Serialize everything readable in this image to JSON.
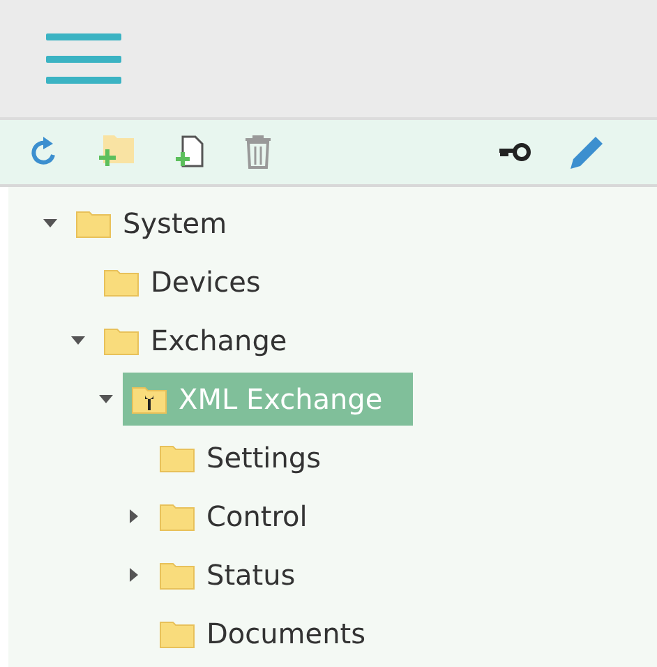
{
  "tree": [
    {
      "label": "System",
      "kind": "folder",
      "expanded": true,
      "selected": false,
      "children": [
        {
          "label": "Devices",
          "kind": "folder",
          "selected": false
        },
        {
          "label": "Exchange",
          "kind": "folder",
          "expanded": true,
          "selected": false,
          "children": [
            {
              "label": "XML Exchange",
              "kind": "tool-folder",
              "expanded": true,
              "selected": true,
              "children": [
                {
                  "label": "Settings",
                  "kind": "folder",
                  "selected": false
                },
                {
                  "label": "Control",
                  "kind": "folder",
                  "expanded": false,
                  "selected": false
                },
                {
                  "label": "Status",
                  "kind": "folder",
                  "expanded": false,
                  "selected": false
                },
                {
                  "label": "Documents",
                  "kind": "folder",
                  "selected": false
                }
              ]
            }
          ]
        }
      ]
    }
  ]
}
